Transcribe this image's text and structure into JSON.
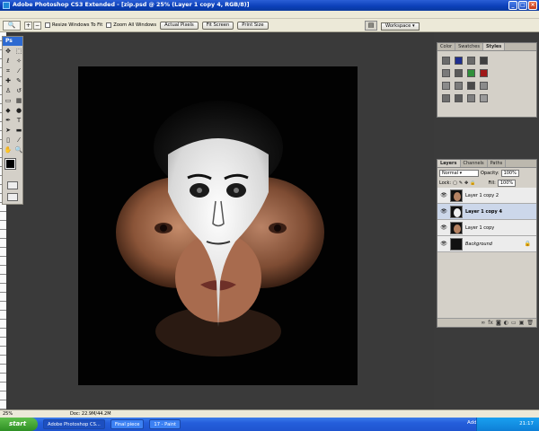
{
  "window": {
    "title": "Adobe Photoshop CS3 Extended - [zip.psd @ 25% (Layer 1 copy 4, RGB/8)]"
  },
  "options_bar": {
    "resize_windows_label": "Resize Windows To Fit",
    "zoom_all_windows_label": "Zoom All Windows",
    "actual_pixels_label": "Actual Pixels",
    "fit_screen_label": "Fit Screen",
    "print_size_label": "Print Size",
    "workspace_label": "Workspace"
  },
  "toolbox": {
    "brand": "Ps"
  },
  "swatch_panel": {
    "tabs": [
      "Color",
      "Swatches",
      "Styles"
    ],
    "active_tab": "Styles",
    "swatches": [
      "#6a6a6a",
      "#1f2e8f",
      "#6a6a6a",
      "#3f3f3f",
      "#7a7a7a",
      "#5a5a5a",
      "#2f8f3a",
      "#a01818",
      "#8a8a8a",
      "#7b7b7b",
      "#4a4a4a",
      "#8b8b8b",
      "#6e6e6e",
      "#5c5c5c",
      "#7f7f7f",
      "#9a9a9a"
    ]
  },
  "layers_panel": {
    "tabs": [
      "Layers",
      "Channels",
      "Paths"
    ],
    "active_tab": "Layers",
    "blend_mode": "Normal",
    "opacity_label": "Opacity:",
    "opacity_value": "100%",
    "lock_label": "Lock:",
    "fill_label": "Fill:",
    "fill_value": "100%",
    "layers": [
      {
        "name": "Layer 1 copy 2",
        "thumb": "face",
        "selected": false
      },
      {
        "name": "Layer 1 copy 4",
        "thumb": "mask",
        "selected": true
      },
      {
        "name": "Layer 1 copy",
        "thumb": "face",
        "selected": false
      },
      {
        "name": "Background",
        "thumb": "black",
        "selected": false
      }
    ]
  },
  "status": {
    "zoom": "25%",
    "doc_size": "Doc: 22.9M/44.2M"
  },
  "taskbar": {
    "start_label": "start",
    "buttons": [
      "Adobe Photoshop CS...",
      "Final piece",
      "17 - Paint"
    ],
    "address_label": "Address",
    "clock": "21:17"
  },
  "colors": {
    "accent": "#245edb",
    "canvas_bg": "#3a3a3a"
  }
}
